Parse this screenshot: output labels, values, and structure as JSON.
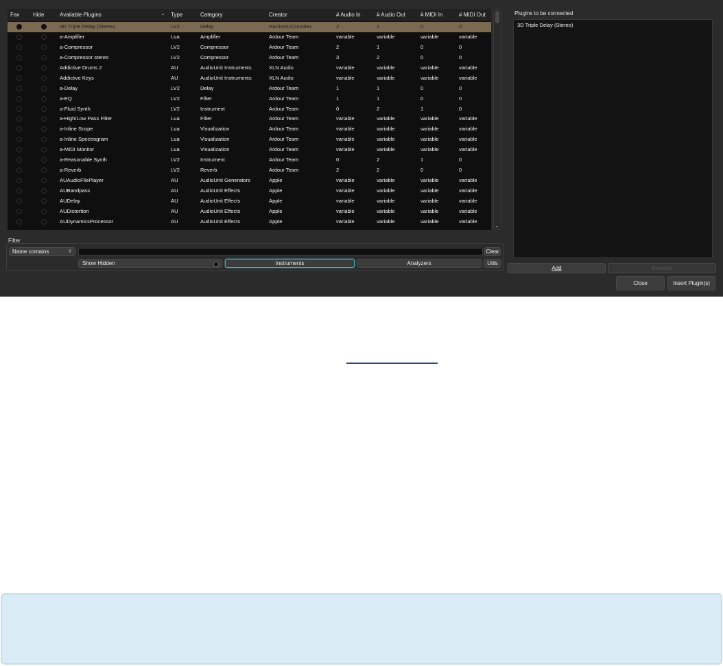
{
  "table": {
    "headers": {
      "fav": "Fav",
      "hide": "Hide",
      "name": "Available Plugins",
      "type": "Type",
      "category": "Category",
      "creator": "Creator",
      "audio_in": "# Audio In",
      "audio_out": "# Audio Out",
      "midi_in": "# MIDI In",
      "midi_out": "# MIDI Out"
    },
    "sort_icon": "chevron-down-icon",
    "rows": [
      {
        "name": "3D Triple Delay (Stereo)",
        "type": "LV2",
        "category": "Delay",
        "creator": "Harrison Consoles",
        "audio_in": "2",
        "audio_out": "2",
        "midi_in": "0",
        "midi_out": "0",
        "selected": true
      },
      {
        "name": "a-Amplifier",
        "type": "Lua",
        "category": "Amplifier",
        "creator": "Ardour Team",
        "audio_in": "variable",
        "audio_out": "variable",
        "midi_in": "variable",
        "midi_out": "variable"
      },
      {
        "name": "a-Compressor",
        "type": "LV2",
        "category": "Compressor",
        "creator": "Ardour Team",
        "audio_in": "2",
        "audio_out": "1",
        "midi_in": "0",
        "midi_out": "0"
      },
      {
        "name": "a-Compressor stereo",
        "type": "LV2",
        "category": "Compressor",
        "creator": "Ardour Team",
        "audio_in": "3",
        "audio_out": "2",
        "midi_in": "0",
        "midi_out": "0"
      },
      {
        "name": "Addictive Drums 2",
        "type": "AU",
        "category": "AudioUnit Instruments",
        "creator": "XLN Audio",
        "audio_in": "variable",
        "audio_out": "variable",
        "midi_in": "variable",
        "midi_out": "variable"
      },
      {
        "name": "Addictive Keys",
        "type": "AU",
        "category": "AudioUnit Instruments",
        "creator": "XLN Audio",
        "audio_in": "variable",
        "audio_out": "variable",
        "midi_in": "variable",
        "midi_out": "variable"
      },
      {
        "name": "a-Delay",
        "type": "LV2",
        "category": "Delay",
        "creator": "Ardour Team",
        "audio_in": "1",
        "audio_out": "1",
        "midi_in": "0",
        "midi_out": "0"
      },
      {
        "name": "a-EQ",
        "type": "LV2",
        "category": "Filter",
        "creator": "Ardour Team",
        "audio_in": "1",
        "audio_out": "1",
        "midi_in": "0",
        "midi_out": "0"
      },
      {
        "name": "a-Fluid Synth",
        "type": "LV2",
        "category": "Instrument",
        "creator": "Ardour Team",
        "audio_in": "0",
        "audio_out": "2",
        "midi_in": "1",
        "midi_out": "0"
      },
      {
        "name": "a-High/Low Pass Filter",
        "type": "Lua",
        "category": "Filter",
        "creator": "Ardour Team",
        "audio_in": "variable",
        "audio_out": "variable",
        "midi_in": "variable",
        "midi_out": "variable"
      },
      {
        "name": "a-Inline Scope",
        "type": "Lua",
        "category": "Visualization",
        "creator": "Ardour Team",
        "audio_in": "variable",
        "audio_out": "variable",
        "midi_in": "variable",
        "midi_out": "variable"
      },
      {
        "name": "a-Inline Spectrogram",
        "type": "Lua",
        "category": "Visualization",
        "creator": "Ardour Team",
        "audio_in": "variable",
        "audio_out": "variable",
        "midi_in": "variable",
        "midi_out": "variable"
      },
      {
        "name": "a-MIDI Monitor",
        "type": "Lua",
        "category": "Visualization",
        "creator": "Ardour Team",
        "audio_in": "variable",
        "audio_out": "variable",
        "midi_in": "variable",
        "midi_out": "variable"
      },
      {
        "name": "a-Reasonable Synth",
        "type": "LV2",
        "category": "Instrument",
        "creator": "Ardour Team",
        "audio_in": "0",
        "audio_out": "2",
        "midi_in": "1",
        "midi_out": "0"
      },
      {
        "name": "a-Reverb",
        "type": "LV2",
        "category": "Reverb",
        "creator": "Ardour Team",
        "audio_in": "2",
        "audio_out": "2",
        "midi_in": "0",
        "midi_out": "0"
      },
      {
        "name": "AUAudioFilePlayer",
        "type": "AU",
        "category": "AudioUnit Generators",
        "creator": "Apple",
        "audio_in": "variable",
        "audio_out": "variable",
        "midi_in": "variable",
        "midi_out": "variable"
      },
      {
        "name": "AUBandpass",
        "type": "AU",
        "category": "AudioUnit Effects",
        "creator": "Apple",
        "audio_in": "variable",
        "audio_out": "variable",
        "midi_in": "variable",
        "midi_out": "variable"
      },
      {
        "name": "AUDelay",
        "type": "AU",
        "category": "AudioUnit Effects",
        "creator": "Apple",
        "audio_in": "variable",
        "audio_out": "variable",
        "midi_in": "variable",
        "midi_out": "variable"
      },
      {
        "name": "AUDistortion",
        "type": "AU",
        "category": "AudioUnit Effects",
        "creator": "Apple",
        "audio_in": "variable",
        "audio_out": "variable",
        "midi_in": "variable",
        "midi_out": "variable"
      },
      {
        "name": "AUDynamicsProcessor",
        "type": "AU",
        "category": "AudioUnit Effects",
        "creator": "Apple",
        "audio_in": "variable",
        "audio_out": "variable",
        "midi_in": "variable",
        "midi_out": "variable"
      }
    ]
  },
  "filter": {
    "label": "Filter",
    "mode": "Name contains",
    "mode_icon": "up-down-arrows-icon",
    "search_value": "",
    "clear": "Clear",
    "show_hidden": "Show Hidden",
    "instruments": "Instruments",
    "analyzers": "Analyzers",
    "utils": "Utils"
  },
  "connected": {
    "label": "Plugins to be connected",
    "items": [
      "3D Triple Delay (Stereo)"
    ]
  },
  "actions": {
    "add": "Add",
    "remove": "Remove",
    "close": "Close",
    "insert": "Insert Plugin(s)"
  },
  "colors": {
    "dialog_bg": "#2b2b2b",
    "selected_row": "#7b6a52",
    "accent_teal": "#3bb2c6",
    "info_panel": "#d9ebf5"
  }
}
